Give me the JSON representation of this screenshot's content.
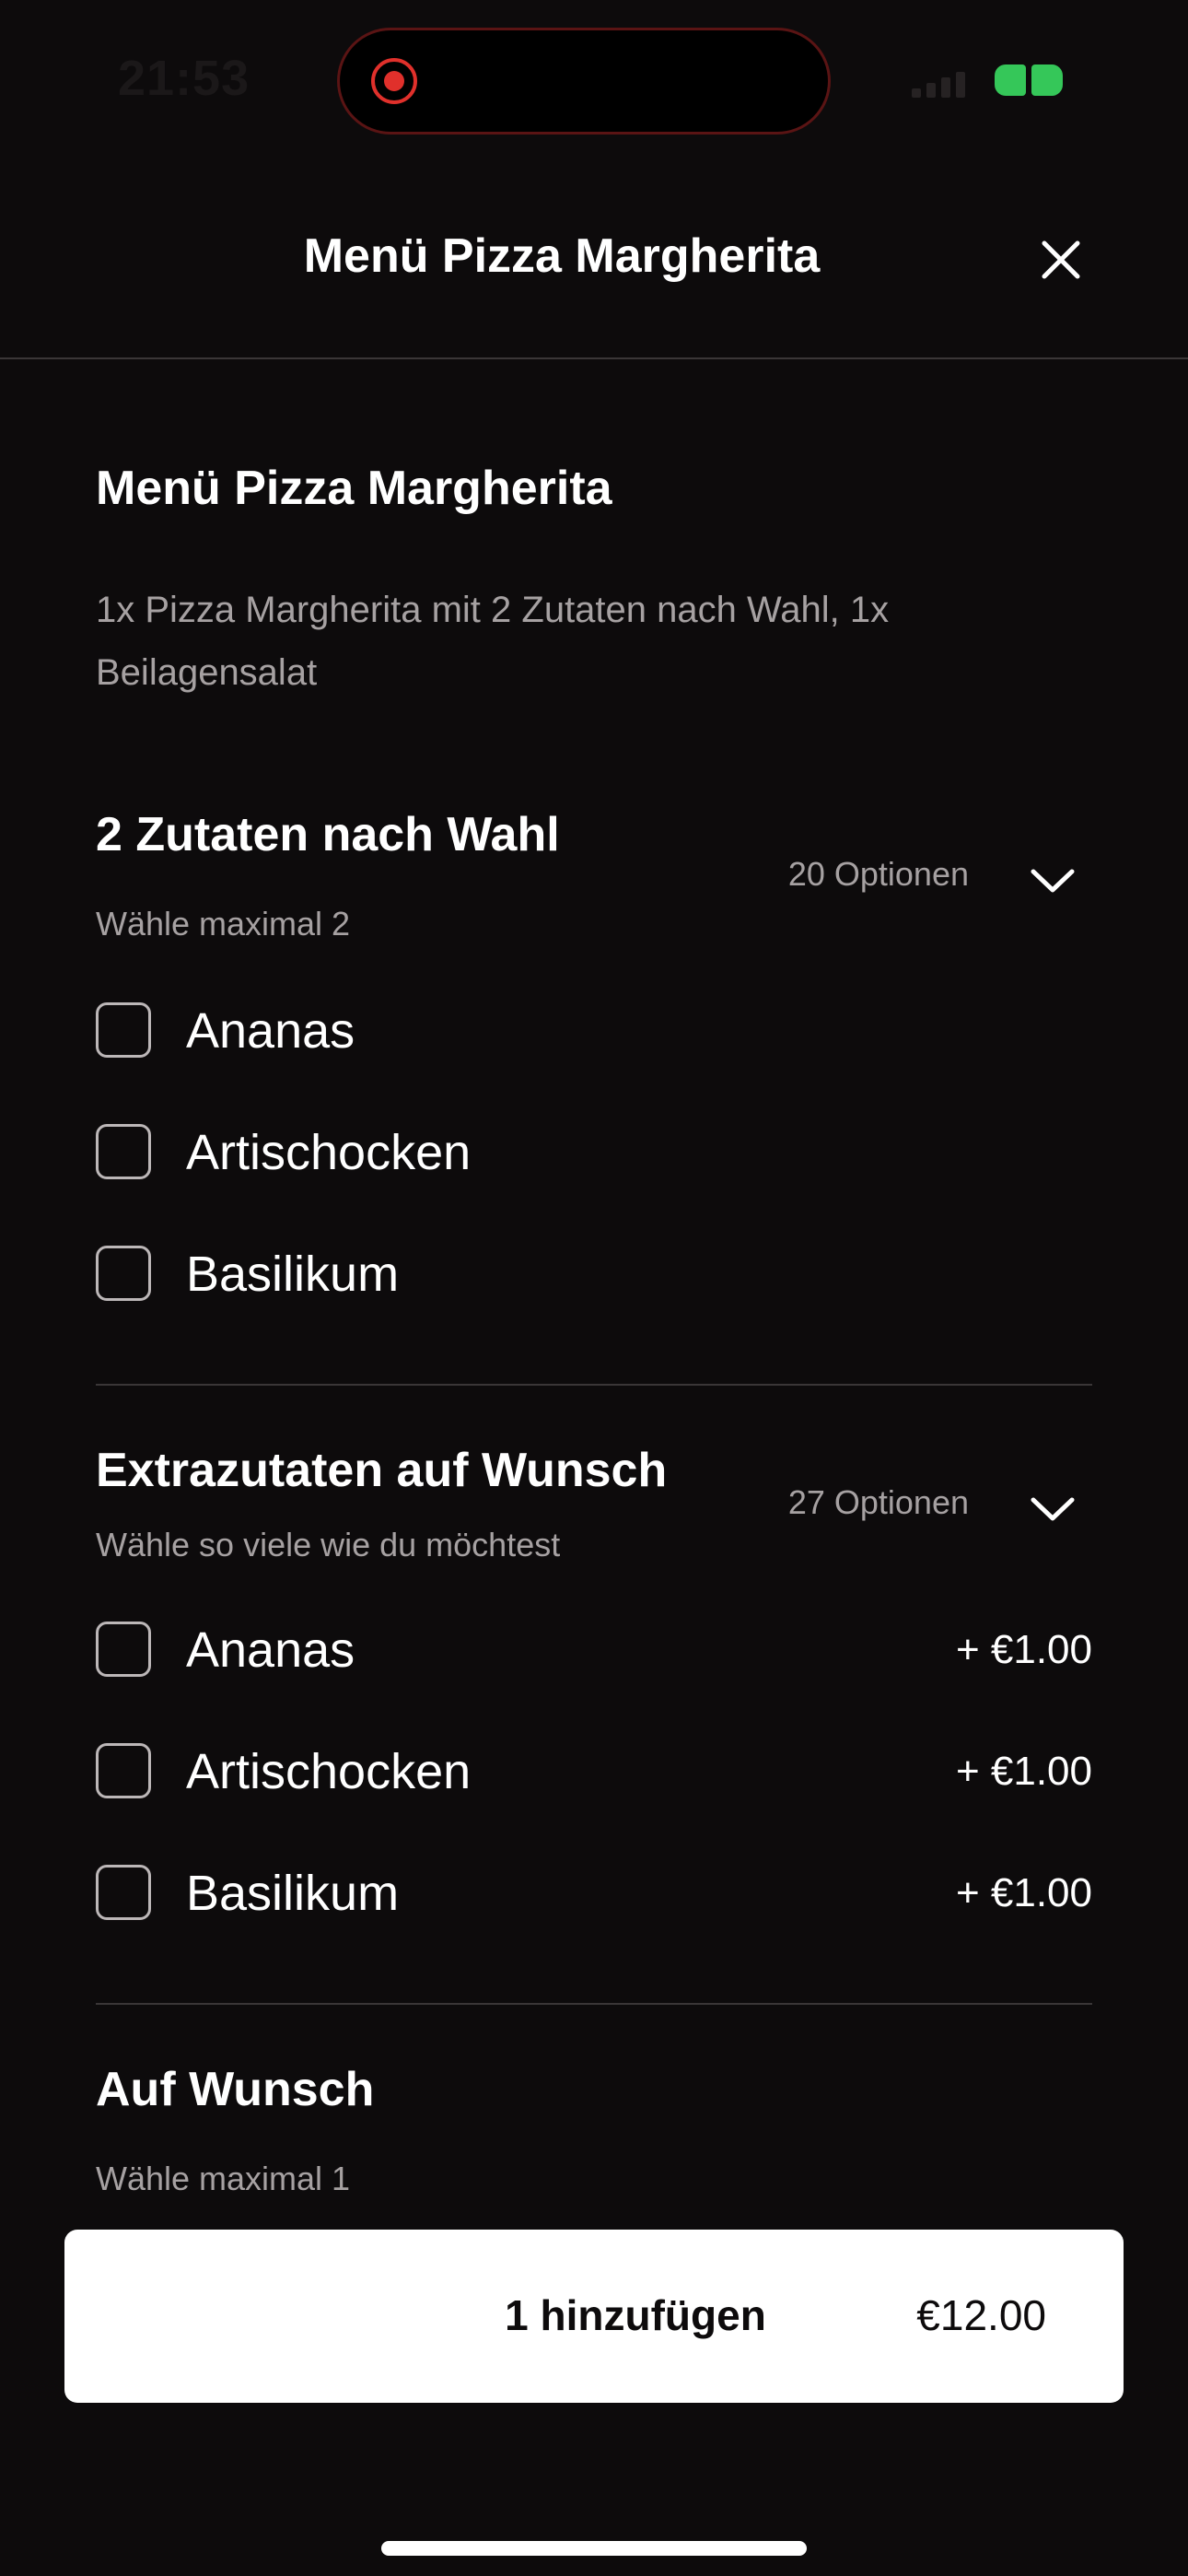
{
  "status_bar": {
    "time": "21:53"
  },
  "header": {
    "title": "Menü Pizza Margherita",
    "close_icon": "close-icon"
  },
  "product": {
    "title": "Menü Pizza Margherita",
    "description": "1x Pizza Margherita mit 2 Zutaten nach Wahl, 1x Beilagensalat"
  },
  "sections": [
    {
      "title": "2 Zutaten nach Wahl",
      "subtitle": "Wähle maximal 2",
      "count": "20 Optionen",
      "options": [
        {
          "label": "Ananas"
        },
        {
          "label": "Artischocken"
        },
        {
          "label": "Basilikum"
        }
      ]
    },
    {
      "title": "Extrazutaten auf Wunsch",
      "subtitle": "Wähle so viele wie du möchtest",
      "count": "27 Optionen",
      "options": [
        {
          "label": "Ananas",
          "price": "+ €1.00"
        },
        {
          "label": "Artischocken",
          "price": "+ €1.00"
        },
        {
          "label": "Basilikum",
          "price": "+ €1.00"
        }
      ]
    },
    {
      "title": "Auf Wunsch",
      "subtitle": "Wähle maximal 1"
    }
  ],
  "footer": {
    "add_label": "1 hinzufügen",
    "price": "€12.00"
  },
  "colors": {
    "background": "#0d0b0c",
    "text_primary": "#ffffff",
    "text_secondary": "#a6a1a2",
    "recording": "#e0302b",
    "battery": "#35c759"
  }
}
